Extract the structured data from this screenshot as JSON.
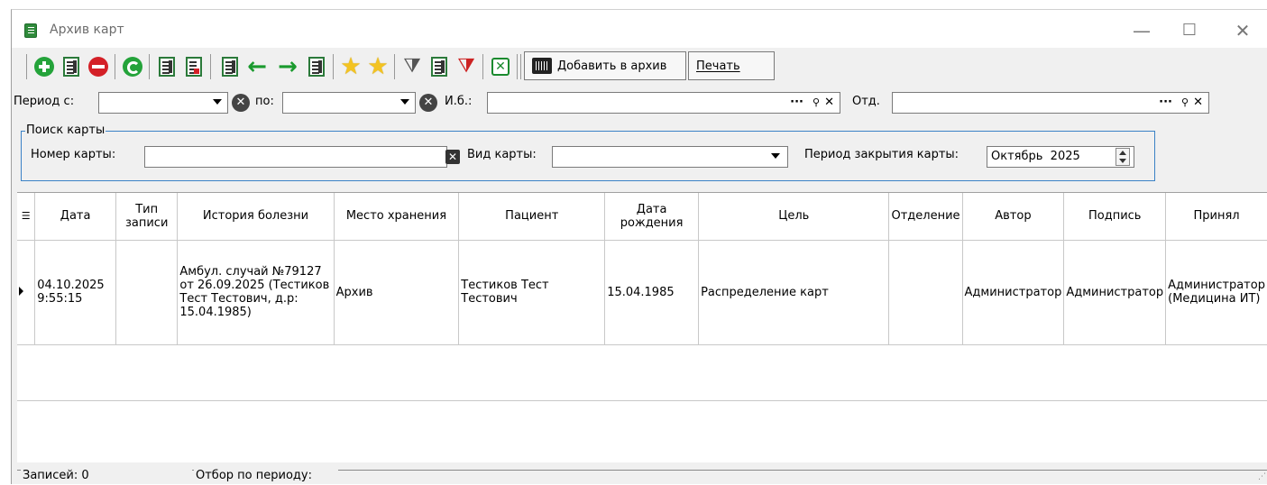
{
  "window": {
    "title": "Архив карт",
    "minimize_glyph": "—",
    "maximize_glyph": "☐",
    "close_glyph": "✕"
  },
  "toolbar": {
    "add_to_archive_label": "Добавить в архив",
    "print_label": "Печать",
    "icons": [
      "add-icon",
      "edit-icon",
      "delete-icon",
      "refresh-icon",
      "doc-edit-icon",
      "doc-delete-icon",
      "doc-prev-icon",
      "arrow-left-icon",
      "arrow-right-icon",
      "doc-next-icon",
      "star-add-icon",
      "star-icon",
      "filter-icon",
      "filter-edit-icon",
      "filter-clear-icon",
      "excel-icon",
      "barcode-icon"
    ]
  },
  "filters": {
    "period_from_label": "Период с:",
    "period_from_value": "",
    "period_to_label": "по:",
    "period_to_value": "",
    "ib_label": "И.б.:",
    "ib_value": "",
    "dept_label": "Отд.",
    "dept_value": "",
    "ellipsis": "···",
    "search_glyph": "🔍",
    "clear_glyph": "✕"
  },
  "card_search": {
    "group_title": "Поиск карты",
    "card_number_label": "Номер карты:",
    "card_number_value": "",
    "card_type_label": "Вид карты:",
    "card_type_value": "",
    "close_period_label": "Период закрытия карты:",
    "close_period_value": "Октябрь  2025"
  },
  "grid": {
    "columns": [
      "Дата",
      "Тип записи",
      "История болезни",
      "Место хранения",
      "Пациент",
      "Дата рождения",
      "Цель",
      "Отделение",
      "Автор",
      "Подпись",
      "Принял"
    ],
    "rows": [
      {
        "date": "04.10.2025 9:55:15",
        "record_type": "",
        "history": "Амбул. случай №79127 от 26.09.2025 (Тестиков Тест Тестович, д.р: 15.04.1985)",
        "storage": "Архив",
        "patient": "Тестиков Тест Тестович",
        "birth_date": "15.04.1985",
        "purpose": "Распределение карт",
        "department": "",
        "author": "Администратор",
        "signature": "Администратор",
        "accepted": "Администратор (Медицина ИТ)"
      }
    ]
  },
  "status": {
    "records_label": "Записей:",
    "records_value": "0",
    "period_filter_label": "Отбор по периоду:"
  },
  "colors": {
    "group_border": "#3b82c6",
    "window_bg": "#f0f0f0",
    "grid_bg": "#ffffff"
  }
}
